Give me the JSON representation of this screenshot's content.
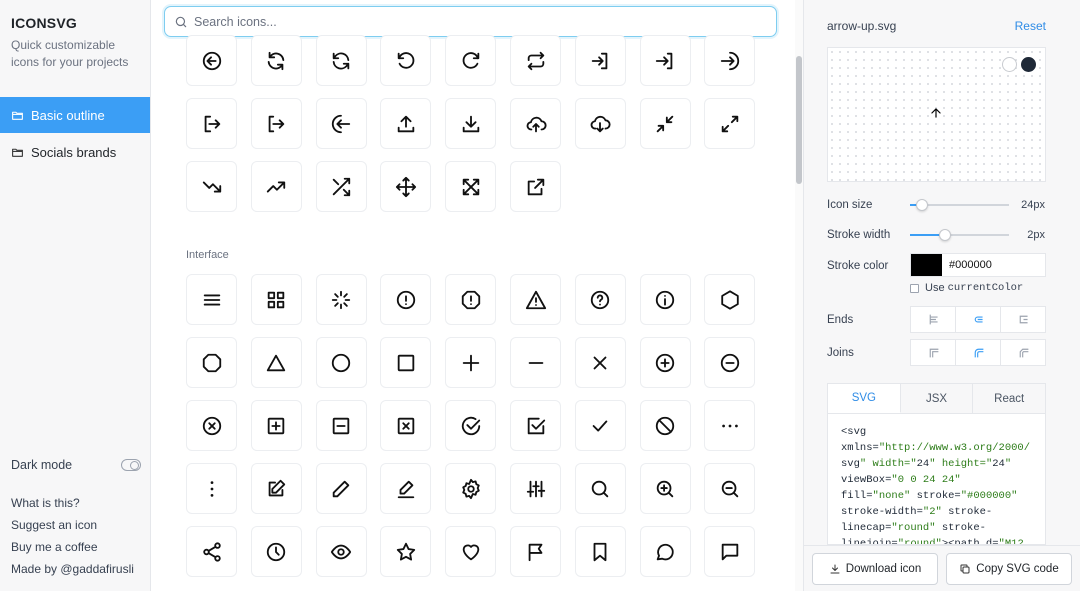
{
  "app": {
    "brand": "ICONSVG",
    "tagline": "Quick customizable icons for your projects"
  },
  "sidebar": {
    "items": [
      {
        "label": "Basic outline",
        "active": true
      },
      {
        "label": "Socials brands",
        "active": false
      }
    ],
    "dark_mode_label": "Dark mode",
    "links": [
      "What is this?",
      "Suggest an icon",
      "Buy me a coffee",
      "Made by @gaddafirusli"
    ]
  },
  "search": {
    "placeholder": "Search icons..."
  },
  "sections": {
    "arrows": {
      "icons": [
        "arrow-left-circle",
        "refresh-alert",
        "refresh",
        "rotate-ccw",
        "rotate-cw",
        "repeat",
        "log-in",
        "log-in-bracket",
        "arrow-right-circle-in",
        "log-out",
        "log-out-bracket",
        "arrow-left-from-circle",
        "upload",
        "download",
        "upload-cloud",
        "download-cloud",
        "minimize",
        "maximize",
        "trending-down",
        "trending-up",
        "shuffle",
        "move",
        "maximize-corners",
        "external-link"
      ]
    },
    "interface": {
      "title": "Interface",
      "icons": [
        "menu",
        "grid",
        "loader",
        "alert-circle",
        "alert-octagon",
        "alert-triangle",
        "help-circle",
        "info",
        "hexagon",
        "octagon",
        "triangle",
        "circle",
        "square",
        "plus",
        "minus",
        "x",
        "plus-circle",
        "minus-circle",
        "x-circle",
        "plus-square",
        "minus-square",
        "x-square",
        "check-circle",
        "check-square",
        "check",
        "slash",
        "more-horizontal",
        "more-vertical",
        "edit",
        "pencil",
        "edit-underline",
        "settings",
        "sliders",
        "search",
        "zoom-in",
        "zoom-out",
        "share",
        "clock",
        "eye",
        "star",
        "heart",
        "flag",
        "bookmark",
        "message-circle",
        "message-square"
      ]
    }
  },
  "panel": {
    "file_name": "arrow-up.svg",
    "reset_label": "Reset",
    "icon_size": {
      "label": "Icon size",
      "value": "24px",
      "fraction": 0.12
    },
    "stroke_width": {
      "label": "Stroke width",
      "value": "2px",
      "fraction": 0.35
    },
    "stroke_color": {
      "label": "Stroke color",
      "value": "#000000"
    },
    "use_current_color": {
      "prefix": "Use ",
      "code": "currentColor",
      "checked": false
    },
    "ends_label": "Ends",
    "joins_label": "Joins",
    "tabs": [
      "SVG",
      "JSX",
      "React"
    ],
    "active_tab": "SVG",
    "code_lines": [
      "<svg",
      "xmlns=\"http://www.w3.org/2000/",
      "svg\" width=\"24\" height=\"24\"",
      "viewBox=\"0 0 24 24\"",
      "fill=\"none\" stroke=\"#000000\"",
      "stroke-width=\"2\" stroke-",
      "linecap=\"round\" stroke-",
      "linejoin=\"round\"><path d=\"M12"
    ],
    "download_label": "Download icon",
    "copy_label": "Copy SVG code"
  },
  "colors": {
    "accent": "#3b9ef5",
    "link": "#2f8ce6",
    "search_border": "#7ecdf0"
  }
}
